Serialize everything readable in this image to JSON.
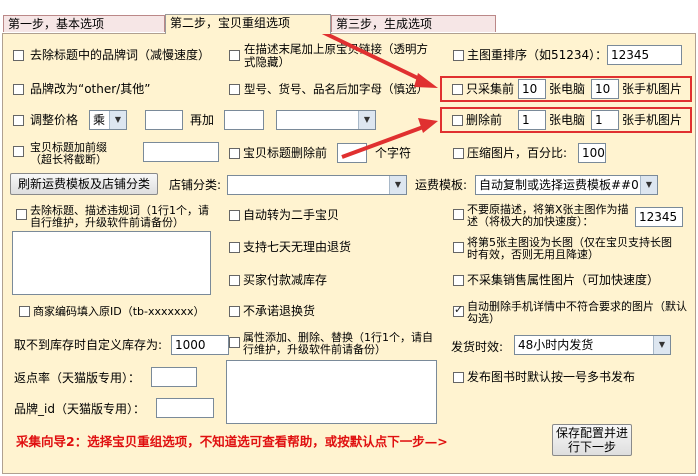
{
  "tabs": [
    {
      "label": "第一步，基本选项"
    },
    {
      "label": "第二步，宝贝重组选项"
    },
    {
      "label": "第三步，生成选项"
    }
  ],
  "col1": {
    "remove_brand": "去除标题中的品牌词（减慢速度）",
    "brand_other": "品牌改为“other/其他”",
    "adjust_price": "调整价格",
    "price_op": "乘",
    "price_add": "再加",
    "title_prefix": "宝贝标题加前缀（超长将截断）",
    "refresh_btn": "刷新运费模板及店铺分类",
    "shop_category": "店铺分类:",
    "remove_desc_words": "去除标题、描述违规词（1行1个，请自行维护，升级软件前请备份）",
    "merchant_code": "商家编码填入原ID（tb-xxxxxxx）",
    "stock_label": "取不到库存时自定义库存为:",
    "stock_value": "1000",
    "rebate_label": "返点率（天猫版专用）：",
    "brand_id_label": "品牌_id（天猫版专用）："
  },
  "col2": {
    "append_link": "在描述末尾加上原宝贝链接（透明方式隐藏）",
    "append_model": "型号、货号、品名后加字母（慎选）",
    "title_delete_prefix": "宝贝标题删除前",
    "chars_unit": "个字符",
    "second_hand": "自动转为二手宝贝",
    "seven_day": "支持七天无理由退货",
    "reduce_stock": "买家付款减库存",
    "no_return": "不承诺退换货",
    "attr_edit": "属性添加、删除、替换（1行1个，请自行维护，升级软件前请备份）"
  },
  "col3": {
    "main_image_reorder": "主图重排序（如51234）：",
    "main_image_order_value": "12345",
    "only_collect_prefix": "只采集前",
    "only_collect_pc": "10",
    "pc_images_unit": "张电脑",
    "only_collect_mobile": "10",
    "mobile_images_unit": "张手机图片",
    "delete_prefix": "删除前",
    "delete_pc": "1",
    "delete_mobile": "1",
    "compress_label": "压缩图片，百分比:",
    "compress_value": "100",
    "freight_label": "运费模板:",
    "freight_value": "自动复制或选择运费模板##0",
    "no_original_desc": "不要原描述，将第X张主图作为描述（将极大的加快速度）：",
    "no_original_desc_value": "12345",
    "fifth_image_long": "将第5张主图设为长图（仅在宝贝支持长图时有效，否则无用且降速）",
    "no_sales_attr_img": "不采集销售属性图片（可加快速度）",
    "auto_delete_mobile": "自动删除手机详情中不符合要求的图片（默认勾选）",
    "ship_time_label": "发货时效:",
    "ship_time_value": "48小时内发货",
    "publish_default": "发布图书时默认按一号多书发布"
  },
  "footer": {
    "guide_text": "采集向导2：选择宝贝重组选项，不知道选可查看帮助，或按默认点下一步—>",
    "next_button": "保存配置并进行下一步"
  },
  "colors": {
    "panel_bg": "#fff3d0",
    "accent_red": "#e03030"
  }
}
